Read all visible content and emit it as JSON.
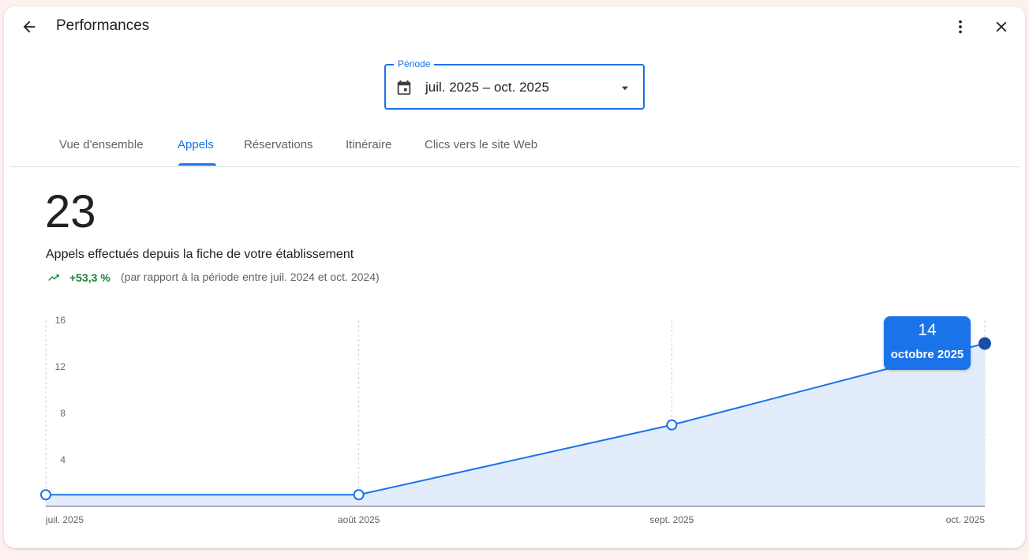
{
  "header": {
    "title": "Performances"
  },
  "period": {
    "label": "Période",
    "value": "juil. 2025 – oct. 2025"
  },
  "tabs": [
    {
      "label": "Vue d'ensemble",
      "active": false
    },
    {
      "label": "Appels",
      "active": true
    },
    {
      "label": "Réservations",
      "active": false
    },
    {
      "label": "Itinéraire",
      "active": false
    },
    {
      "label": "Clics vers le site Web",
      "active": false
    }
  ],
  "metric": {
    "value": "23",
    "description": "Appels effectués depuis la fiche de votre établissement",
    "trend_value": "+53,3 %",
    "trend_comparison": "(par rapport à la période entre juil. 2024 et oct. 2024)"
  },
  "icons": {
    "back": "arrow-back-icon",
    "more": "more-vert-icon",
    "close": "close-icon",
    "calendar": "calendar-icon",
    "caret": "arrow-drop-down-icon",
    "trend": "trending-up-icon"
  },
  "colors": {
    "accent": "#1a73e8",
    "positive": "#188038",
    "area_fill": "#e3ecfb",
    "series_line": "#1a73e8"
  },
  "chart_data": {
    "type": "area",
    "categories": [
      "juil. 2025",
      "août 2025",
      "sept. 2025",
      "oct. 2025"
    ],
    "values": [
      1,
      1,
      7,
      14
    ],
    "ylim": [
      0,
      16
    ],
    "yticks": [
      4,
      8,
      12,
      16
    ],
    "grid": "vertical-dashed",
    "tooltip": {
      "value": "14",
      "label": "octobre 2025"
    }
  }
}
